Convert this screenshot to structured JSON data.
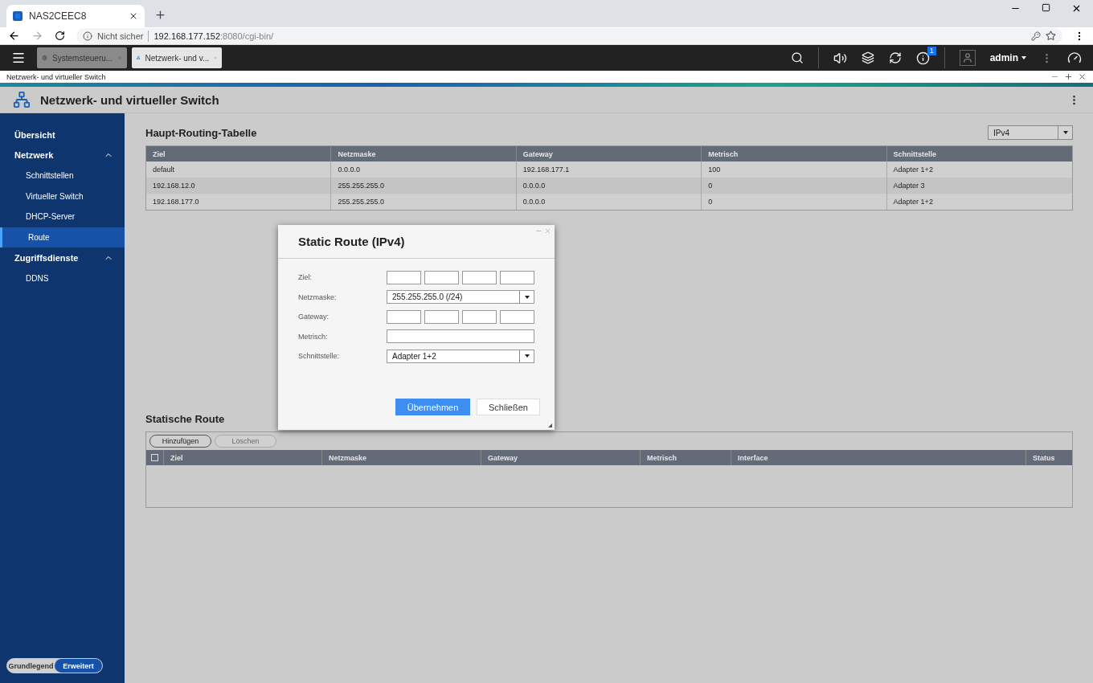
{
  "browser": {
    "tab": {
      "title": "NAS2CEEC8"
    },
    "address": {
      "security": "Nicht sicher",
      "host": "192.168.177.152",
      "path": ":8080/cgi-bin/"
    }
  },
  "taskbar": {
    "apps": [
      {
        "label": "Systemsteueru...",
        "kind": "settings",
        "selected": false
      },
      {
        "label": "Netzwerk- und v...",
        "kind": "network",
        "selected": true
      }
    ],
    "notification_count": "1",
    "user": "admin"
  },
  "window": {
    "title": "Netzwerk- und virtueller Switch",
    "app_title": "Netzwerk- und virtueller Switch"
  },
  "sidebar": {
    "items": [
      {
        "label": "Übersicht",
        "selected": false
      },
      {
        "label": "Netzwerk",
        "selected": false,
        "expanded": true,
        "children": [
          {
            "label": "Schnittstellen",
            "selected": false
          },
          {
            "label": "Virtueller Switch",
            "selected": false
          },
          {
            "label": "DHCP-Server",
            "selected": false
          },
          {
            "label": "Route",
            "selected": true
          }
        ]
      },
      {
        "label": "Zugriffsdienste",
        "selected": false,
        "expanded": true,
        "children": [
          {
            "label": "DDNS",
            "selected": false
          }
        ]
      }
    ],
    "mode_toggle": [
      {
        "label": "Grundlegend",
        "selected": false
      },
      {
        "label": "Erweitert",
        "selected": true
      }
    ]
  },
  "routing_table": {
    "title": "Haupt-Routing-Tabelle",
    "protocol": "IPv4",
    "columns": [
      "Ziel",
      "Netzmaske",
      "Gateway",
      "Metrisch",
      "Schnittstelle"
    ],
    "rows": [
      [
        "default",
        "0.0.0.0",
        "192.168.177.1",
        "100",
        "Adapter 1+2"
      ],
      [
        "192.168.12.0",
        "255.255.255.0",
        "0.0.0.0",
        "0",
        "Adapter 3"
      ],
      [
        "192.168.177.0",
        "255.255.255.0",
        "0.0.0.0",
        "0",
        "Adapter 1+2"
      ]
    ]
  },
  "static_routes": {
    "title": "Statische Route",
    "buttons": [
      {
        "label": "Hinzufügen",
        "disabled": false
      },
      {
        "label": "Löschen",
        "disabled": true
      }
    ],
    "select_all_checked": false,
    "columns": [
      "Ziel",
      "Netzmaske",
      "Gateway",
      "Metrisch",
      "Interface",
      "Status"
    ]
  },
  "dialog": {
    "title": "Static Route (IPv4)",
    "fields": [
      {
        "label": "Ziel:",
        "kind": "ip"
      },
      {
        "label": "Netzmaske:",
        "kind": "select",
        "value": "255.255.255.0 (/24)"
      },
      {
        "label": "Gateway:",
        "kind": "ip"
      },
      {
        "label": "Metrisch:",
        "kind": "text"
      },
      {
        "label": "Schnittstelle:",
        "kind": "select",
        "value": "Adapter 1+2"
      }
    ],
    "buttons": [
      {
        "label": "Übernehmen",
        "kind": "primary"
      },
      {
        "label": "Schließen",
        "kind": "secondary"
      }
    ]
  }
}
